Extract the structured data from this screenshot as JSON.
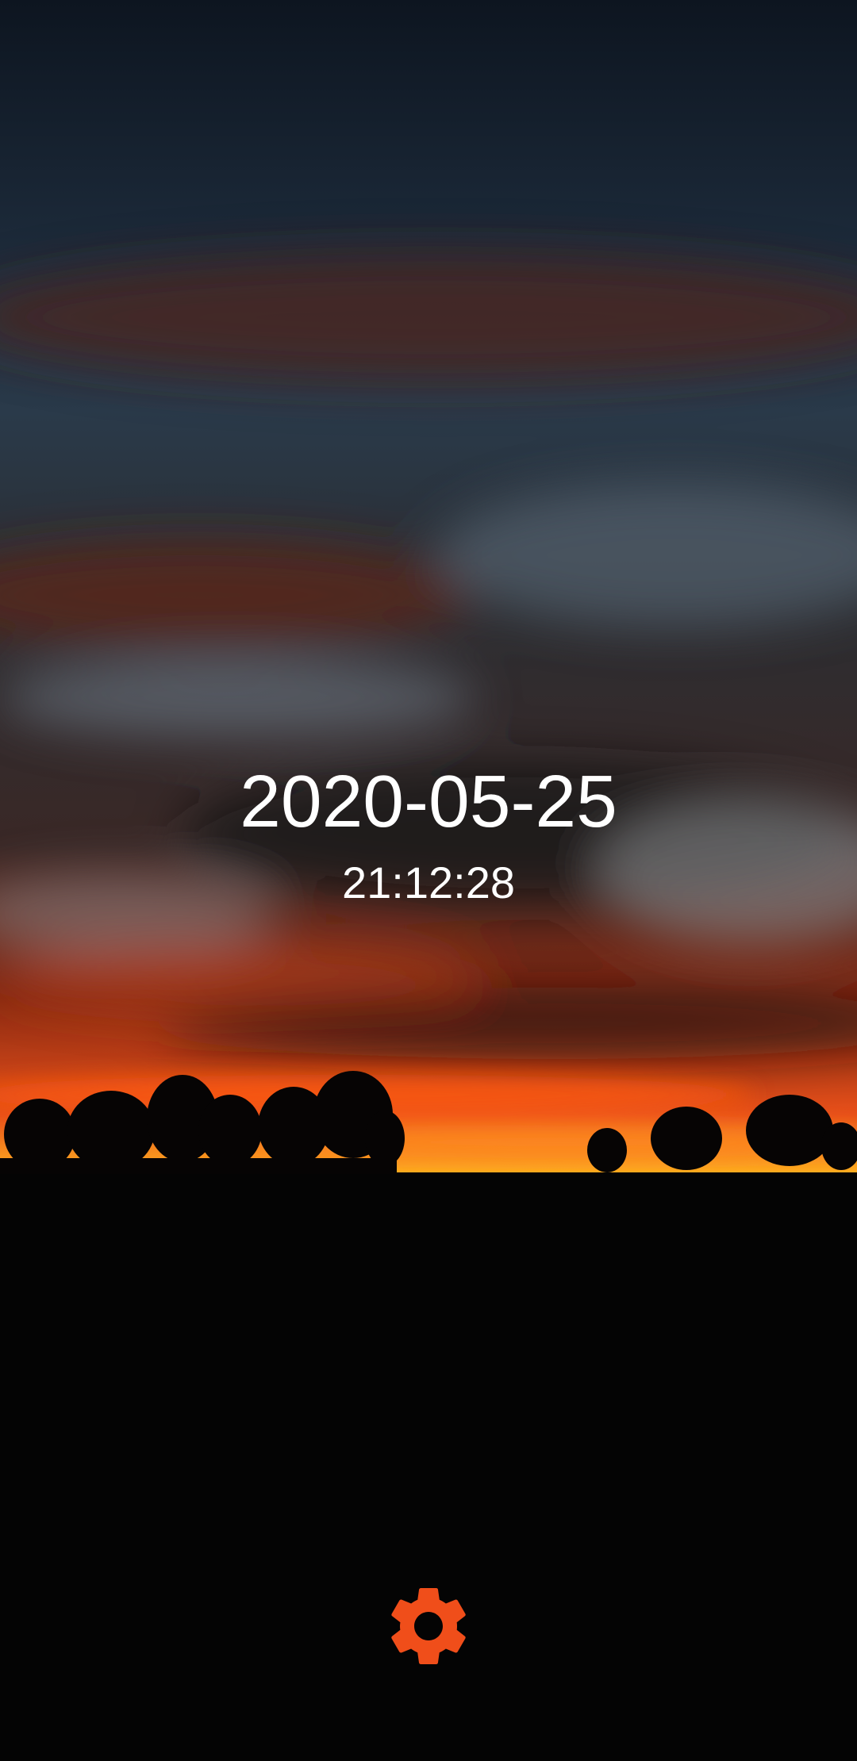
{
  "lockscreen": {
    "date": "2020-05-25",
    "time": "21:12:28"
  },
  "settings_button": {
    "icon": "gear-icon",
    "color": "#F04E1A"
  }
}
